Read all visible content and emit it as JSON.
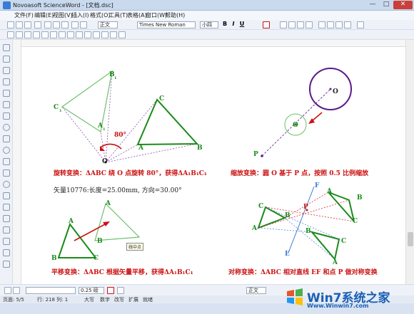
{
  "window": {
    "title": "Novoasoft ScienceWord - [文档.dsc]",
    "min_glyph": "—",
    "max_glyph": "□",
    "close_glyph": "✕"
  },
  "menu": {
    "items": [
      "文件(F)",
      "编辑(E)",
      "视图(V)",
      "插入(I)",
      "格式(O)",
      "工具(T)",
      "表格(A)",
      "窗口(W)",
      "帮助(H)"
    ]
  },
  "toolbar": {
    "style_value": "正文",
    "font_value": "Times New Roman",
    "size_value": "小四",
    "bold": "B",
    "italic": "I",
    "underline": "U",
    "line_width": "0.25 磅",
    "para_style": "正文"
  },
  "document": {
    "captions": {
      "rotate": "旋转变换：ΔABC 绕 O 点旋转 80°，获得ΔA₁B₁C₁",
      "scale": "缩放变换：圆 O 基于 P 点，按照 0.5 比例缩放",
      "translate": "平移变换：ΔABC 根据矢量平移，获得ΔA₁B₁C₁",
      "symmetry": "对称变换：ΔABC 相对直线 EF 和点 P 做对称变换"
    },
    "vector_info": "矢量10776:长度=25.00mm, 方向=30.00°",
    "tooltip": "线中点",
    "angle_label": "80°",
    "labels": {
      "A": "A",
      "B": "B",
      "C": "C",
      "O": "O",
      "P": "P",
      "E": "E",
      "F": "F",
      "A1": "A",
      "B1": "B",
      "C1": "C",
      "sub1": "1"
    }
  },
  "status": {
    "page": "页面: 5/5",
    "line": "行: 218 列: 1",
    "caps": "大写",
    "num": "数字",
    "ins": "改写",
    "ext": "扩展",
    "ready": "就绪"
  },
  "watermark": {
    "text": "Win7系统之家",
    "url": "Www.Winwin7.com"
  },
  "colors": {
    "green": "#1a8a1a",
    "red": "#cc1111",
    "purple": "#5a1a8a"
  }
}
